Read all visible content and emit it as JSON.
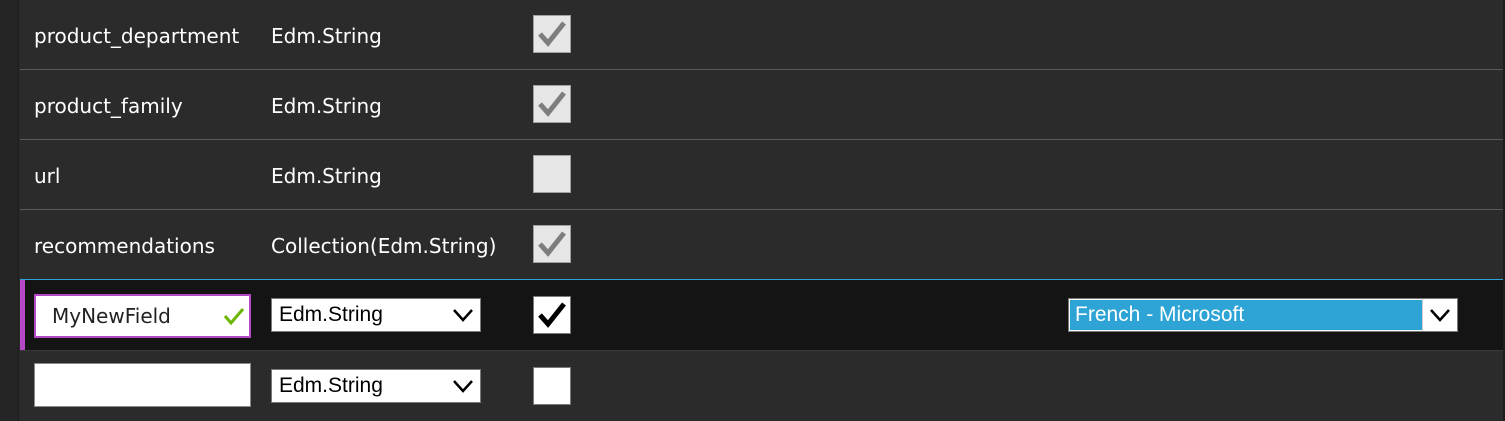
{
  "fields": [
    {
      "name": "product_department",
      "type": "Edm.String",
      "checked": true
    },
    {
      "name": "product_family",
      "type": "Edm.String",
      "checked": true
    },
    {
      "name": "url",
      "type": "Edm.String",
      "checked": false
    },
    {
      "name": "recommendations",
      "type": "Collection(Edm.String)",
      "checked": true
    }
  ],
  "new_field": {
    "name": "MyNewField",
    "type": "Edm.String",
    "checked": true,
    "analyzer": "French - Microsoft"
  },
  "empty_field": {
    "name": "",
    "type": "Edm.String",
    "checked": false
  },
  "colors": {
    "selected_accent": "#b548c6",
    "row_divider_highlight": "#2ea4d6",
    "valid_check": "#6bb700",
    "analyzer_highlight": "#2ea4d6"
  }
}
